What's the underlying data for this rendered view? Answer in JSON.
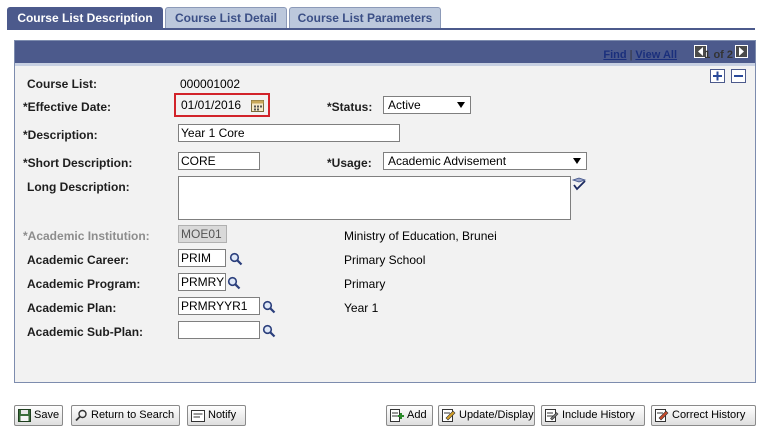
{
  "tabs": [
    {
      "label": "Course List Description",
      "active": true
    },
    {
      "label": "Course List Detail",
      "active": false
    },
    {
      "label": "Course List Parameters",
      "active": false
    }
  ],
  "header": {
    "find": "Find",
    "view_all": "View All",
    "separator": "|",
    "page_count": "1 of 2"
  },
  "form": {
    "course_list_label": "Course List:",
    "course_list_value": "000001002",
    "effective_date_label": "*Effective Date:",
    "effective_date_value": "01/01/2016",
    "status_label": "*Status:",
    "status_value": "Active",
    "description_label": "*Description:",
    "description_value": "Year 1 Core",
    "short_description_label": "*Short Description:",
    "short_description_value": "CORE",
    "usage_label": "*Usage:",
    "usage_value": "Academic Advisement",
    "long_description_label": "Long Description:",
    "long_description_value": "",
    "institution_label": "*Academic Institution:",
    "institution_value": "MOE01",
    "institution_desc": "Ministry of Education, Brunei",
    "career_label": "Academic Career:",
    "career_value": "PRIM",
    "career_desc": "Primary School",
    "program_label": "Academic Program:",
    "program_value": "PRMRY",
    "program_desc": "Primary",
    "plan_label": "Academic Plan:",
    "plan_value": "PRMRYYR1",
    "plan_desc": "Year 1",
    "subplan_label": "Academic Sub-Plan:",
    "subplan_value": ""
  },
  "buttons": {
    "save": "Save",
    "return_to_search": "Return to Search",
    "notify": "Notify",
    "add": "Add",
    "update_display": "Update/Display",
    "include_history": "Include History",
    "correct_history": "Correct History"
  },
  "colors": {
    "tab_active": "#4c5a8c",
    "tab_inactive": "#bcc8dc",
    "highlight": "#d2232a"
  }
}
